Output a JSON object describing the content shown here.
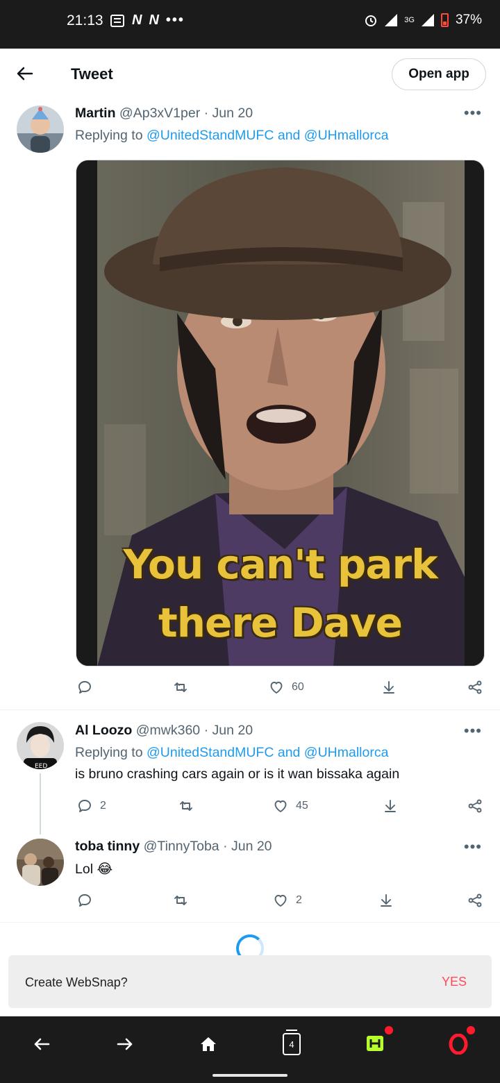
{
  "status_bar": {
    "time": "21:13",
    "left_icons": [
      "news-icon",
      "N",
      "N",
      "more-dots-icon"
    ],
    "network": "3G",
    "battery": "37%",
    "colors": {
      "battery_low": "#ff4a3a"
    }
  },
  "header": {
    "title": "Tweet",
    "open_app_label": "Open app"
  },
  "tweets": [
    {
      "name": "Martin",
      "handle": "@Ap3xV1per",
      "date": "· Jun 20",
      "replying_prefix": "Replying to ",
      "replying_to": "@UnitedStandMUFC and @UHmallorca",
      "media_caption_line1": "You can't park",
      "media_caption_line2": "there Dave",
      "replies": "",
      "retweets": "",
      "likes": "60"
    },
    {
      "name": "Al Loozo",
      "handle": "@mwk360",
      "date": "· Jun 20",
      "replying_prefix": "Replying to ",
      "replying_to": "@UnitedStandMUFC and @UHmallorca",
      "text": "is bruno crashing cars again or is it wan bissaka again",
      "replies": "2",
      "retweets": "",
      "likes": "45"
    },
    {
      "name": "toba tinny",
      "handle": "@TinnyToba",
      "date": "· Jun 20",
      "text": "Lol 😂",
      "replies": "",
      "retweets": "",
      "likes": "2"
    }
  ],
  "websnap": {
    "prompt": "Create WebSnap?",
    "action": "YES"
  },
  "bottom_nav": {
    "tab_count": "4"
  },
  "colors": {
    "link": "#1d9bf0",
    "secondary_text": "#536471",
    "accent_red": "#ff1b2d",
    "caption_yellow": "#e8c23a"
  }
}
